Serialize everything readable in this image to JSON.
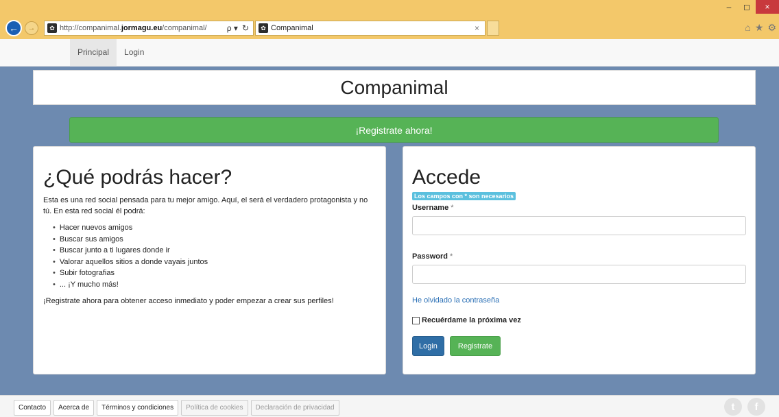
{
  "browser": {
    "url_prefix": "http://companimal.",
    "url_domain": "jormagu.eu",
    "url_path": "/companimal/",
    "search_tool": "ρ ▾",
    "refresh_tool": "↻",
    "tab_title": "Companimal",
    "tab_close": "×",
    "window_controls": [
      "–",
      "◻",
      "×"
    ],
    "toolbar_icons": [
      "⌂",
      "★",
      "⚙"
    ]
  },
  "navbar": {
    "items": [
      {
        "label": "Principal",
        "active": true
      },
      {
        "label": "Login",
        "active": false
      }
    ]
  },
  "header": {
    "title": "Companimal"
  },
  "register_bar": {
    "label": "¡Registrate ahora!"
  },
  "info": {
    "title": "¿Qué podrás hacer?",
    "intro": "Esta es una red social pensada para tu mejor amigo. Aquí, el será el verdadero protagonista y no tú. En esta red social él podrá:",
    "features": [
      "Hacer nuevos amigos",
      "Buscar sus amigos",
      "Buscar junto a ti lugares donde ir",
      "Valorar aquellos sitios a donde vayais juntos",
      "Subir fotografias",
      "... ¡Y mucho más!"
    ],
    "cta": "¡Registrate ahora para obtener acceso inmediato y poder empezar a crear sus perfiles!"
  },
  "login": {
    "title": "Accede",
    "required_hint": "Los campos con * son necesarios",
    "username_label": "Username",
    "password_label": "Password",
    "required_mark": "*",
    "username_value": "",
    "password_value": "",
    "forgot_link": "He olvidado la contraseña",
    "remember_label": "Recuérdame la próxima vez",
    "remember_checked": false,
    "login_button": "Login",
    "register_button": "Registrate"
  },
  "footer": {
    "links": [
      "Contacto",
      "Acerca de",
      "Términos y condiciones",
      "Política de cookies",
      "Declaración de privacidad"
    ],
    "social": [
      "twitter-icon",
      "facebook-icon"
    ]
  }
}
